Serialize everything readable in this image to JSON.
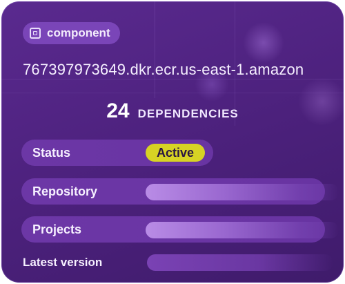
{
  "badge": {
    "label": "component",
    "icon": "component-icon"
  },
  "image_uri": "767397973649.dkr.ecr.us-east-1.amazon",
  "dependencies": {
    "count": "24",
    "label": "DEPENDENCIES"
  },
  "fields": {
    "status": {
      "label": "Status",
      "value": "Active",
      "value_color": "#d7d324"
    },
    "repository": {
      "label": "Repository"
    },
    "projects": {
      "label": "Projects"
    },
    "latest_version": {
      "label": "Latest version"
    }
  },
  "colors": {
    "card_bg": "#4e227f",
    "badge_bg": "#7a45b8",
    "accent_active": "#d7d324"
  }
}
